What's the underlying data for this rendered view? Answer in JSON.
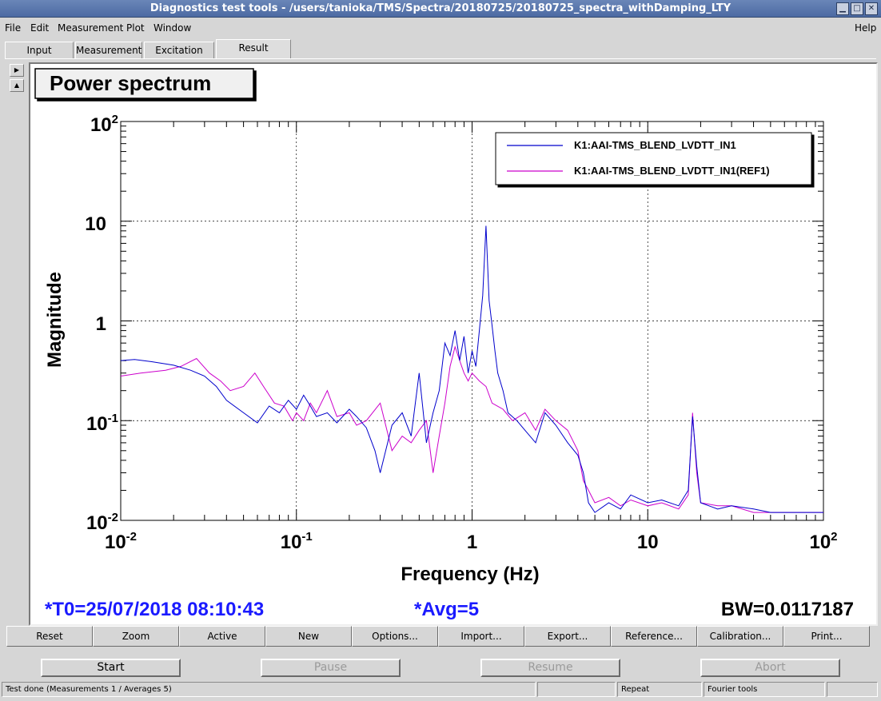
{
  "window": {
    "title": "Diagnostics test tools - /users/tanioka/TMS/Spectra/20180725/20180725_spectra_withDamping_LTY",
    "buttons": {
      "minimize": "▁",
      "maximize": "□",
      "close": "✕"
    }
  },
  "menu": {
    "items": [
      {
        "label": "File"
      },
      {
        "label": "Edit"
      },
      {
        "label": "Measurement"
      },
      {
        "label": "Plot"
      },
      {
        "label": "Window"
      }
    ],
    "help": "Help"
  },
  "tabs": [
    {
      "label": "Input"
    },
    {
      "label": "Measurement"
    },
    {
      "label": "Excitation"
    },
    {
      "label": "Result"
    }
  ],
  "side_buttons": {
    "up": "▲",
    "right": "▶"
  },
  "plot": {
    "title": "Power spectrum",
    "xlabel": "Frequency (Hz)",
    "ylabel": "Magnitude",
    "t0": "*T0=25/07/2018 08:10:43",
    "avg": "*Avg=5",
    "bw": "BW=0.0117187",
    "xticks": [
      {
        "base": "10",
        "exp": "-2"
      },
      {
        "base": "10",
        "exp": "-1"
      },
      {
        "base": "1",
        "exp": ""
      },
      {
        "base": "10",
        "exp": ""
      },
      {
        "base": "10",
        "exp": "2"
      }
    ],
    "yticks": [
      {
        "base": "10",
        "exp": "2"
      },
      {
        "base": "10",
        "exp": ""
      },
      {
        "base": "1",
        "exp": ""
      },
      {
        "base": "10",
        "exp": "-1"
      },
      {
        "base": "10",
        "exp": "-2"
      }
    ]
  },
  "chart_data": {
    "type": "line",
    "title": "Power spectrum",
    "xlabel": "Frequency (Hz)",
    "ylabel": "Magnitude",
    "xscale": "log",
    "yscale": "log",
    "xlim": [
      0.01,
      100
    ],
    "ylim": [
      0.01,
      100
    ],
    "grid": true,
    "legend": "top-right",
    "series": [
      {
        "name": "K1:AAI-TMS_BLEND_LVDTT_IN1",
        "color": "#0000cc",
        "x": [
          0.01,
          0.012,
          0.015,
          0.02,
          0.025,
          0.03,
          0.035,
          0.04,
          0.05,
          0.06,
          0.07,
          0.08,
          0.09,
          0.1,
          0.11,
          0.12,
          0.13,
          0.15,
          0.17,
          0.2,
          0.22,
          0.25,
          0.28,
          0.3,
          0.35,
          0.4,
          0.45,
          0.5,
          0.55,
          0.6,
          0.65,
          0.7,
          0.75,
          0.8,
          0.85,
          0.9,
          0.95,
          1.0,
          1.05,
          1.1,
          1.15,
          1.2,
          1.25,
          1.3,
          1.35,
          1.4,
          1.5,
          1.6,
          1.8,
          2.0,
          2.3,
          2.6,
          3.0,
          3.5,
          4.0,
          4.3,
          4.6,
          5.0,
          6.0,
          7.0,
          8.0,
          10.0,
          12.0,
          15.0,
          17.0,
          18.0,
          19.0,
          20.0,
          25.0,
          30.0,
          40.0,
          50.0,
          70.0,
          100.0
        ],
        "y": [
          0.4,
          0.41,
          0.39,
          0.36,
          0.32,
          0.28,
          0.22,
          0.16,
          0.12,
          0.095,
          0.14,
          0.12,
          0.16,
          0.13,
          0.18,
          0.14,
          0.11,
          0.12,
          0.095,
          0.13,
          0.11,
          0.085,
          0.05,
          0.03,
          0.09,
          0.12,
          0.07,
          0.3,
          0.06,
          0.12,
          0.2,
          0.6,
          0.45,
          0.8,
          0.4,
          0.7,
          0.3,
          0.5,
          0.35,
          0.8,
          1.8,
          9.0,
          1.6,
          0.9,
          0.5,
          0.3,
          0.2,
          0.12,
          0.1,
          0.08,
          0.06,
          0.12,
          0.09,
          0.06,
          0.045,
          0.03,
          0.015,
          0.012,
          0.015,
          0.013,
          0.018,
          0.015,
          0.016,
          0.014,
          0.02,
          0.11,
          0.035,
          0.015,
          0.013,
          0.014,
          0.013,
          0.012,
          0.012,
          0.012
        ]
      },
      {
        "name": "K1:AAI-TMS_BLEND_LVDTT_IN1(REF1)",
        "color": "#cc00cc",
        "x": [
          0.01,
          0.013,
          0.018,
          0.022,
          0.027,
          0.032,
          0.037,
          0.042,
          0.05,
          0.058,
          0.065,
          0.075,
          0.085,
          0.095,
          0.1,
          0.11,
          0.12,
          0.13,
          0.15,
          0.17,
          0.2,
          0.22,
          0.25,
          0.3,
          0.35,
          0.4,
          0.45,
          0.5,
          0.55,
          0.6,
          0.65,
          0.7,
          0.75,
          0.8,
          0.85,
          0.9,
          0.95,
          1.0,
          1.1,
          1.2,
          1.3,
          1.5,
          1.7,
          2.0,
          2.3,
          2.6,
          3.0,
          3.5,
          4.0,
          4.3,
          4.6,
          5.0,
          6.0,
          7.0,
          8.0,
          10.0,
          12.0,
          15.0,
          17.0,
          18.0,
          19.0,
          20.0,
          25.0,
          30.0,
          40.0,
          50.0,
          70.0,
          100.0
        ],
        "y": [
          0.28,
          0.3,
          0.32,
          0.35,
          0.42,
          0.3,
          0.25,
          0.2,
          0.22,
          0.3,
          0.22,
          0.15,
          0.14,
          0.1,
          0.12,
          0.1,
          0.15,
          0.12,
          0.2,
          0.11,
          0.12,
          0.09,
          0.1,
          0.15,
          0.05,
          0.07,
          0.06,
          0.08,
          0.1,
          0.03,
          0.07,
          0.15,
          0.35,
          0.55,
          0.4,
          0.3,
          0.25,
          0.3,
          0.25,
          0.22,
          0.15,
          0.13,
          0.1,
          0.12,
          0.08,
          0.13,
          0.1,
          0.08,
          0.05,
          0.025,
          0.02,
          0.015,
          0.017,
          0.014,
          0.016,
          0.014,
          0.015,
          0.013,
          0.018,
          0.12,
          0.03,
          0.015,
          0.014,
          0.014,
          0.012,
          0.012,
          0.012,
          0.012
        ]
      }
    ]
  },
  "toolbar": [
    {
      "label": "Reset"
    },
    {
      "label": "Zoom"
    },
    {
      "label": "Active"
    },
    {
      "label": "New"
    },
    {
      "label": "Options..."
    },
    {
      "label": "Import..."
    },
    {
      "label": "Export..."
    },
    {
      "label": "Reference..."
    },
    {
      "label": "Calibration..."
    },
    {
      "label": "Print..."
    }
  ],
  "run_buttons": [
    {
      "label": "Start",
      "enabled": true
    },
    {
      "label": "Pause",
      "enabled": false
    },
    {
      "label": "Resume",
      "enabled": false
    },
    {
      "label": "Abort",
      "enabled": false
    }
  ],
  "status": {
    "message": "Test done (Measurements 1 / Averages 5)",
    "field2": "",
    "field3": "Repeat",
    "field4": "Fourier tools",
    "field5": ""
  }
}
